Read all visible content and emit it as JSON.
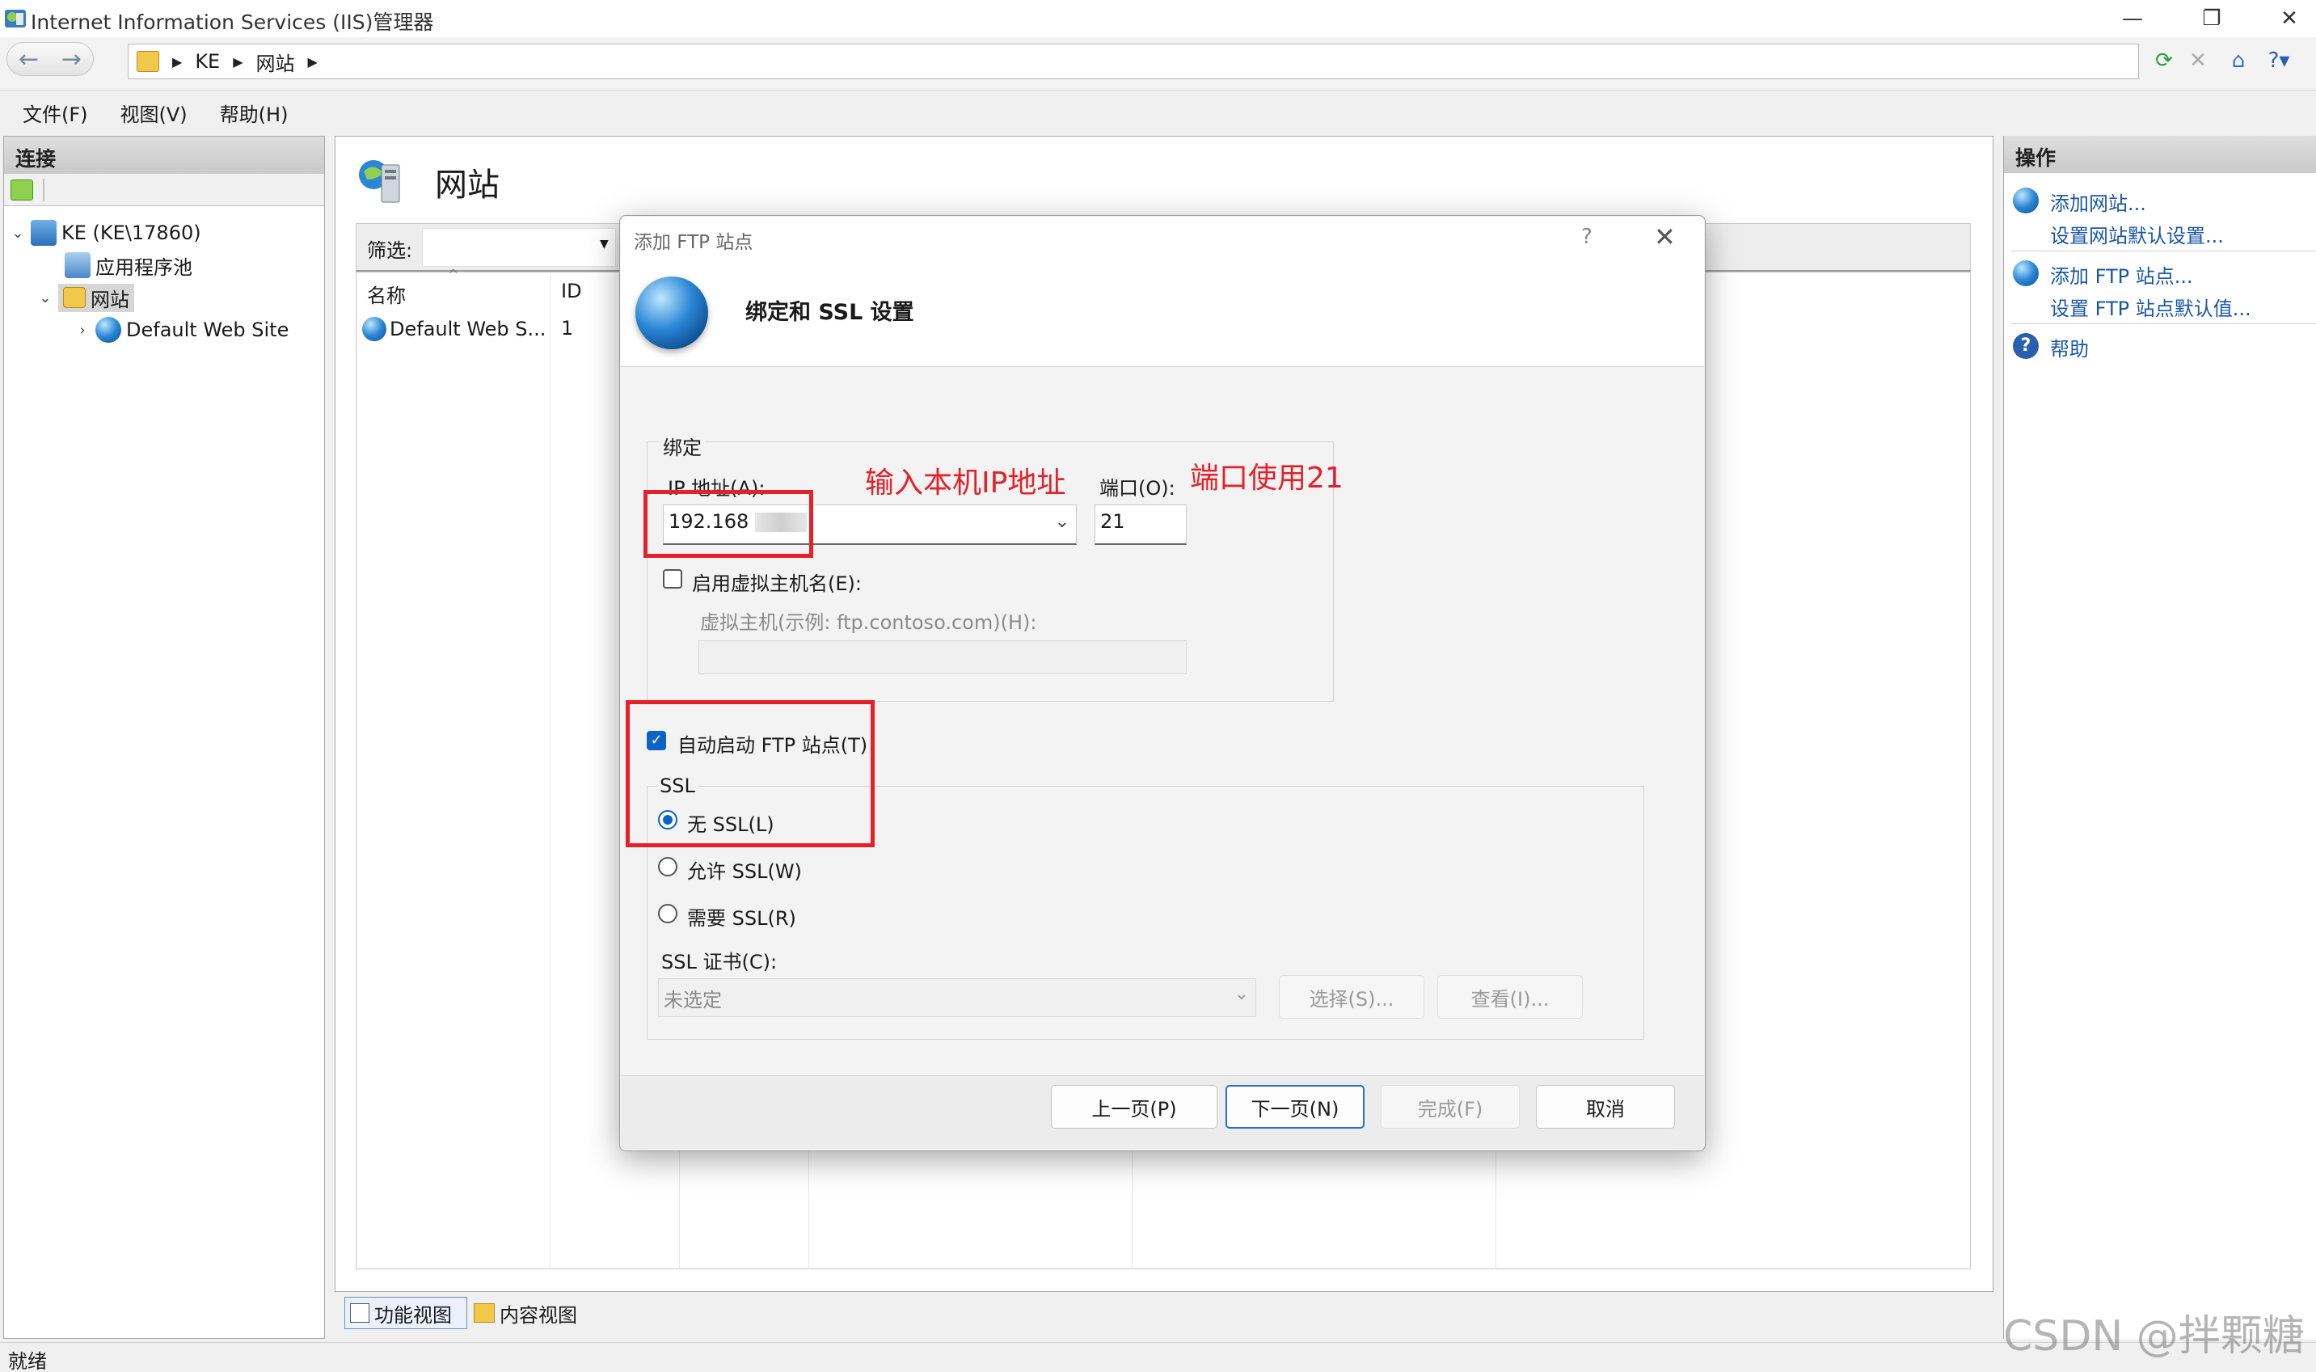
{
  "window": {
    "title": "Internet Information Services (IIS)管理器"
  },
  "address": {
    "crumbs": [
      "KE",
      "网站"
    ]
  },
  "menu": {
    "file": "文件(F)",
    "view": "视图(V)",
    "help": "帮助(H)"
  },
  "connections": {
    "header": "连接",
    "tree": {
      "server": "KE (KE\\17860)",
      "app_pools": "应用程序池",
      "sites": "网站",
      "default_site": "Default Web Site"
    }
  },
  "center": {
    "title": "网站",
    "filter_label": "筛选:",
    "columns": {
      "name": "名称",
      "id": "ID"
    },
    "rows": [
      {
        "name": "Default Web S...",
        "id": "1"
      }
    ],
    "tabs": {
      "feature_view": "功能视图",
      "content_view": "内容视图"
    }
  },
  "actions": {
    "header": "操作",
    "add_site": "添加网站...",
    "site_defaults": "设置网站默认设置...",
    "add_ftp": "添加 FTP 站点...",
    "ftp_defaults": "设置 FTP 站点默认值...",
    "help": "帮助"
  },
  "status": {
    "text": "就绪"
  },
  "watermark": "CSDN @拌颗糖",
  "dialog": {
    "title": "添加 FTP 站点",
    "help": "?",
    "close": "✕",
    "heading": "绑定和 SSL 设置",
    "binding_group": "绑定",
    "ip_label": "IP 地址(A):",
    "ip_value": "192.168",
    "port_label": "端口(O):",
    "port_value": "21",
    "virtual_host_check": "启用虚拟主机名(E):",
    "virtual_host_label": "虚拟主机(示例: ftp.contoso.com)(H):",
    "virtual_host_value": "",
    "auto_start": "自动启动 FTP 站点(T)",
    "ssl_group": "SSL",
    "ssl_none": "无 SSL(L)",
    "ssl_allow": "允许 SSL(W)",
    "ssl_require": "需要 SSL(R)",
    "ssl_cert_label": "SSL 证书(C):",
    "ssl_cert_value": "未选定",
    "select_btn": "选择(S)...",
    "view_btn": "查看(I)...",
    "prev_btn": "上一页(P)",
    "next_btn": "下一页(N)",
    "finish_btn": "完成(F)",
    "cancel_btn": "取消"
  },
  "annotations": {
    "ip_hint": "输入本机IP地址",
    "port_hint": "端口使用21"
  },
  "colors": {
    "annotation_red": "#e5202a",
    "link_blue": "#1a56a8",
    "accent": "#0b63c6"
  }
}
